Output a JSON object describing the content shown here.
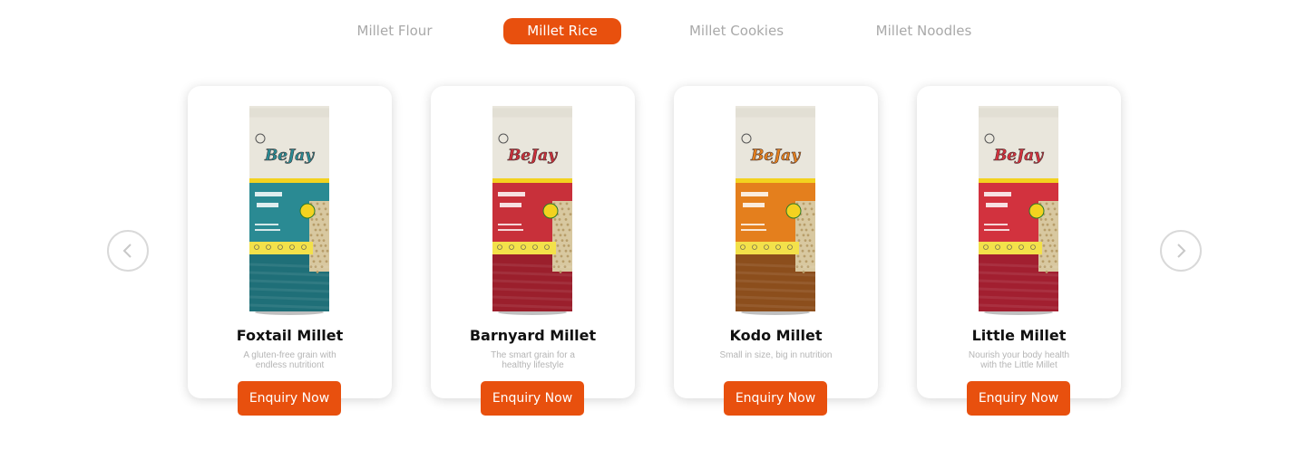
{
  "tabs": [
    {
      "label": "Millet Flour",
      "active": false
    },
    {
      "label": "Millet Rice",
      "active": true
    },
    {
      "label": "Millet Cookies",
      "active": false
    },
    {
      "label": "Millet Noodles",
      "active": false
    }
  ],
  "carousel": {
    "prev_icon": "chevron-left-icon",
    "next_icon": "chevron-right-icon"
  },
  "products": [
    {
      "name": "Foxtail Millet",
      "description": "A gluten-free grain with endless nutritiont",
      "button_label": "Enquiry Now",
      "pack_brand": "BeJay",
      "pack_color": "#2a8a93",
      "pack_color_dark": "#1f6f78"
    },
    {
      "name": "Barnyard Millet",
      "description": "The smart grain for a healthy lifestyle",
      "button_label": "Enquiry Now",
      "pack_brand": "BeJay",
      "pack_color": "#c8303a",
      "pack_color_dark": "#9b1f2c"
    },
    {
      "name": "Kodo Millet",
      "description": "Small in size, big in nutrition",
      "button_label": "Enquiry Now",
      "pack_brand": "BeJay",
      "pack_color": "#e47f1d",
      "pack_color_dark": "#8c4e1c"
    },
    {
      "name": "Little Millet",
      "description": "Nourish your body health with the Little Millet",
      "button_label": "Enquiry Now",
      "pack_brand": "BeJay",
      "pack_color": "#d2323e",
      "pack_color_dark": "#a21f30"
    }
  ],
  "colors": {
    "accent": "#e8500e",
    "tab_inactive": "#a9a9a9"
  }
}
